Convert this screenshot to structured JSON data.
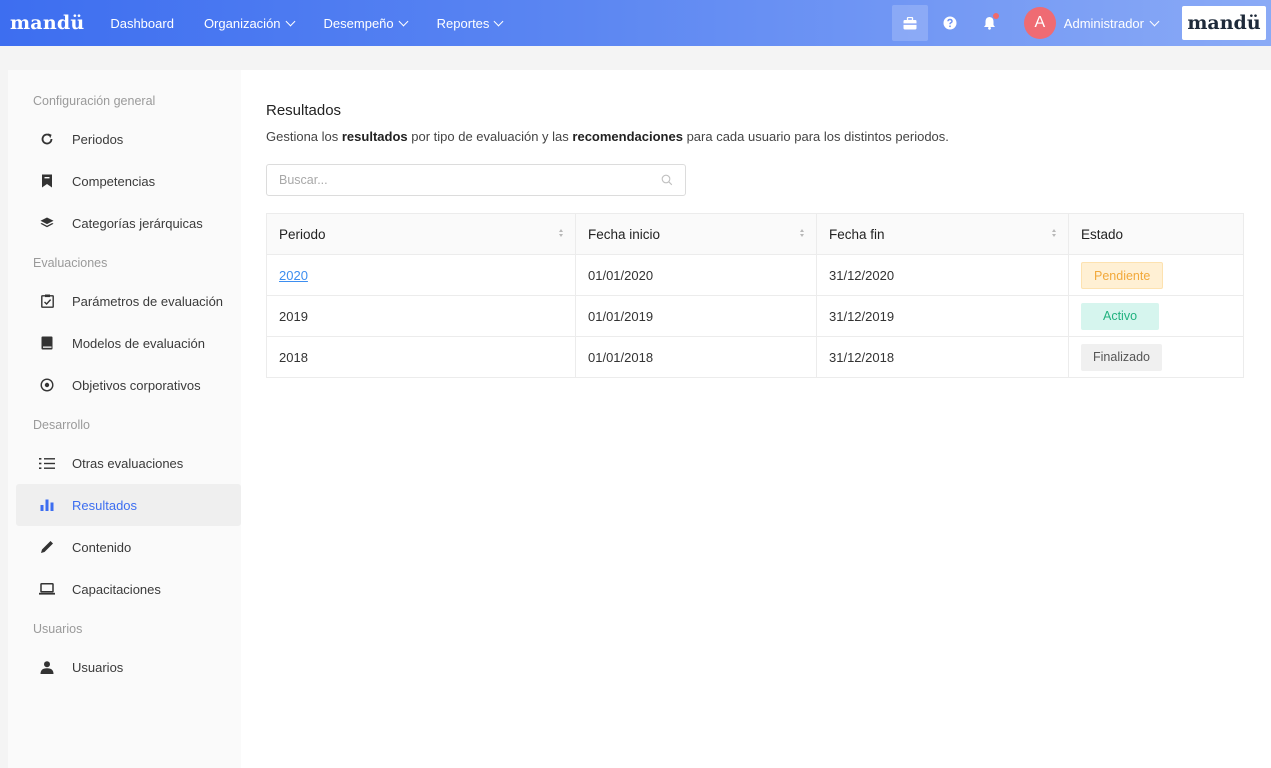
{
  "topbar": {
    "brand": "mandü",
    "nav": [
      {
        "label": "Dashboard",
        "dropdown": false
      },
      {
        "label": "Organización",
        "dropdown": true
      },
      {
        "label": "Desempeño",
        "dropdown": true
      },
      {
        "label": "Reportes",
        "dropdown": true
      }
    ],
    "avatar_initial": "A",
    "user_name": "Administrador",
    "brand_right": "mandü",
    "colors": {
      "accent": "#3d6ef0",
      "avatar": "#ef6b73"
    }
  },
  "sidebar": {
    "sections": [
      {
        "title": "Configuración general",
        "items": [
          {
            "label": "Periodos",
            "icon": "refresh-icon"
          },
          {
            "label": "Competencias",
            "icon": "bookmark-icon"
          },
          {
            "label": "Categorías jerárquicas",
            "icon": "layers-icon"
          }
        ]
      },
      {
        "title": "Evaluaciones",
        "items": [
          {
            "label": "Parámetros de evaluación",
            "icon": "checklist-icon"
          },
          {
            "label": "Modelos de evaluación",
            "icon": "book-icon"
          },
          {
            "label": "Objetivos corporativos",
            "icon": "target-icon"
          }
        ]
      },
      {
        "title": "Desarrollo",
        "items": [
          {
            "label": "Otras evaluaciones",
            "icon": "list-icon"
          },
          {
            "label": "Resultados",
            "icon": "bar-chart-icon",
            "active": true
          },
          {
            "label": "Contenido",
            "icon": "pencil-icon"
          },
          {
            "label": "Capacitaciones",
            "icon": "laptop-icon"
          }
        ]
      },
      {
        "title": "Usuarios",
        "items": [
          {
            "label": "Usuarios",
            "icon": "user-icon"
          }
        ]
      }
    ]
  },
  "main": {
    "title": "Resultados",
    "description": {
      "p1": "Gestiona los ",
      "b1": "resultados",
      "p2": " por tipo de evaluación y las ",
      "b2": "recomendaciones",
      "p3": " para cada usuario para los distintos periodos."
    },
    "search": {
      "placeholder": "Buscar..."
    },
    "table": {
      "columns": [
        "Periodo",
        "Fecha inicio",
        "Fecha fin",
        "Estado"
      ],
      "rows": [
        {
          "periodo": "2020",
          "inicio": "01/01/2020",
          "fin": "31/12/2020",
          "estado": "Pendiente",
          "status": "pendiente",
          "link": true
        },
        {
          "periodo": "2019",
          "inicio": "01/01/2019",
          "fin": "31/12/2019",
          "estado": "Activo",
          "status": "activo",
          "link": false
        },
        {
          "periodo": "2018",
          "inicio": "01/01/2018",
          "fin": "31/12/2018",
          "estado": "Finalizado",
          "status": "finalizado",
          "link": false
        }
      ]
    }
  }
}
